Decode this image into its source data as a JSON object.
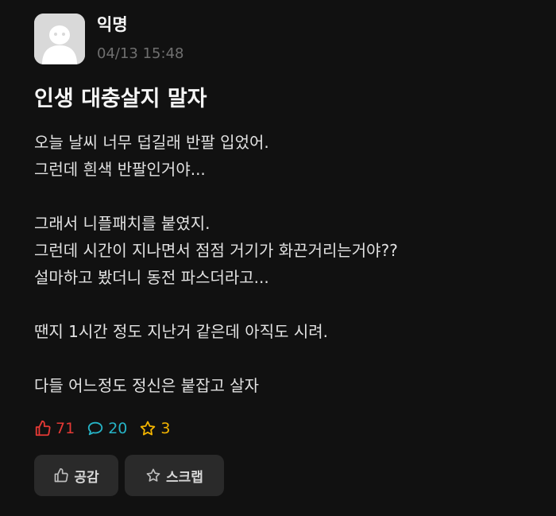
{
  "post": {
    "author": "익명",
    "timestamp": "04/13 15:48",
    "title": "인생 대충살지 말자",
    "content": "오늘 날씨 너무 덥길래 반팔 입었어.\n그런데 흰색 반팔인거야...\n\n그래서 니플패치를 붙였지.\n그런데 시간이 지나면서 점점 거기가 화끈거리는거야??\n설마하고 봤더니 동전 파스더라고...\n\n땐지 1시간 정도 지난거 같은데 아직도 시려.\n\n다들 어느정도 정신은 붙잡고 살자"
  },
  "stats": {
    "likes": "71",
    "comments": "20",
    "scraps": "3"
  },
  "actions": {
    "like_label": "공감",
    "scrap_label": "스크랩"
  },
  "colors": {
    "background": "#111111",
    "like": "#e53935",
    "comment": "#26b3c6",
    "scrap": "#f3b400",
    "button_bg": "#2a2a2a"
  },
  "icons": {
    "avatar": "default-avatar-icon",
    "like": "thumbs-up-icon",
    "comment": "speech-bubble-icon",
    "scrap": "star-icon"
  }
}
